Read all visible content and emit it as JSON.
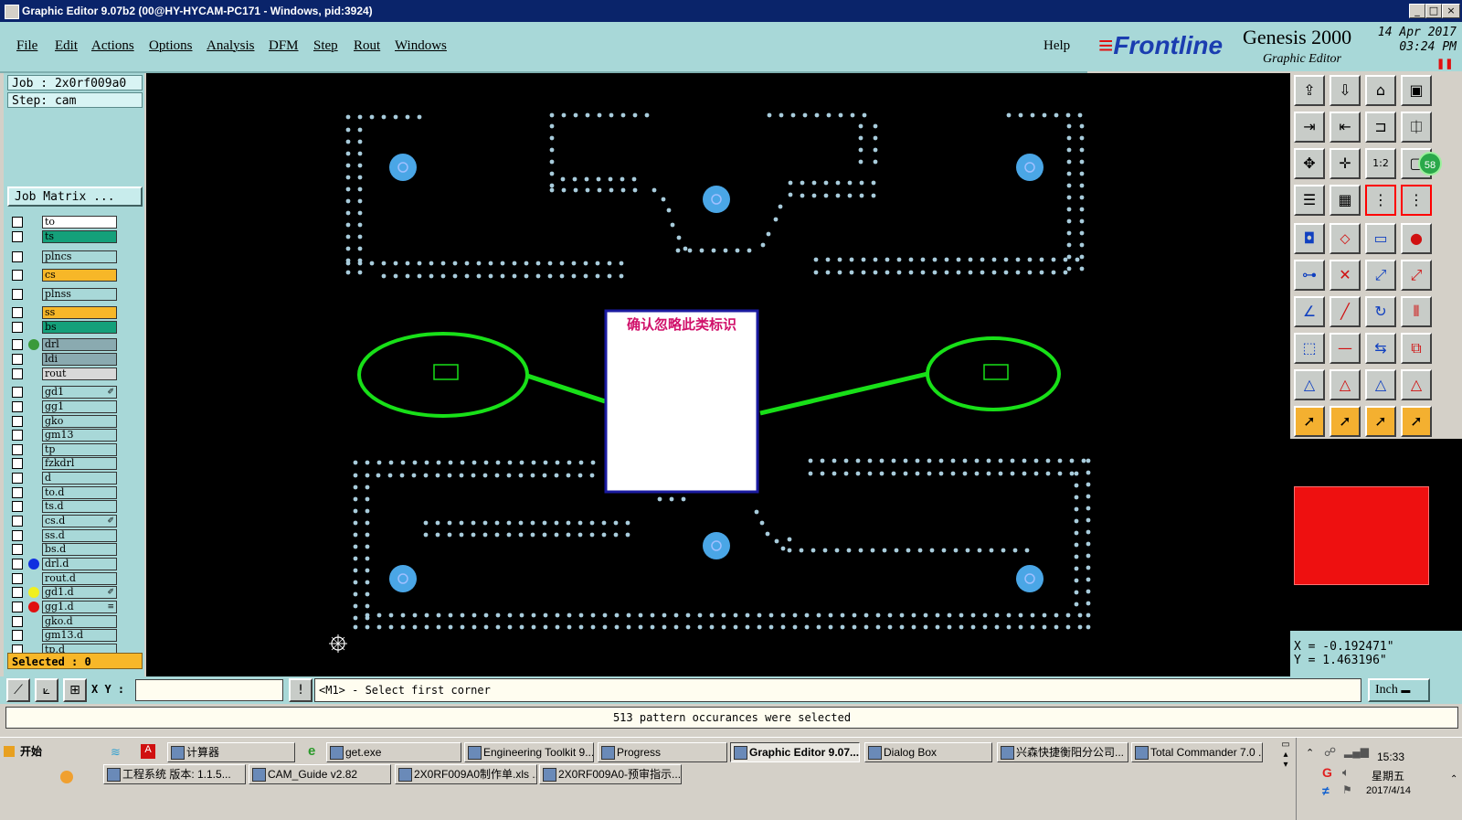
{
  "window": {
    "title": "Graphic Editor 9.07b2 (00@HY-HYCAM-PC171 - Windows, pid:3924)"
  },
  "menu": [
    "File",
    "Edit",
    "Actions",
    "Options",
    "Analysis",
    "DFM",
    "Step",
    "Rout",
    "Windows"
  ],
  "help": "Help",
  "brand": {
    "logo": "Frontline",
    "product": "Genesis 2000",
    "subtitle": "Graphic Editor",
    "date": "14 Apr 2017",
    "time": "03:24 PM"
  },
  "job": {
    "job_line": "Job : 2x0rf009a0",
    "step_line": "Step: cam",
    "matrix_button": "Job Matrix ..."
  },
  "layers": [
    {
      "name": "to",
      "color": "#ffffff"
    },
    {
      "name": "ts",
      "color": "#14a07a"
    },
    {
      "name": "plncs",
      "color": "#a8d8d8"
    },
    {
      "name": "cs",
      "color": "#f7b728"
    },
    {
      "name": "plnss",
      "color": "#a8d8d8"
    },
    {
      "name": "ss",
      "color": "#f7b728"
    },
    {
      "name": "bs",
      "color": "#14a07a"
    },
    {
      "name": "drl",
      "color": "#8aaab0",
      "dot": "#3a9a3a"
    },
    {
      "name": "ldi",
      "color": "#8aaab0"
    },
    {
      "name": "rout",
      "color": "#d8d8d8"
    },
    {
      "name": "gd1",
      "color": "#a8d8d8",
      "mark": "✐"
    },
    {
      "name": "gg1",
      "color": "#a8d8d8"
    },
    {
      "name": "gko",
      "color": "#a8d8d8"
    },
    {
      "name": "gm13",
      "color": "#a8d8d8"
    },
    {
      "name": "tp",
      "color": "#a8d8d8"
    },
    {
      "name": "fzkdrl",
      "color": "#a8d8d8"
    },
    {
      "name": "d",
      "color": "#a8d8d8"
    },
    {
      "name": "to.d",
      "color": "#a8d8d8"
    },
    {
      "name": "ts.d",
      "color": "#a8d8d8"
    },
    {
      "name": "cs.d",
      "color": "#a8d8d8",
      "mark": "✐"
    },
    {
      "name": "ss.d",
      "color": "#a8d8d8"
    },
    {
      "name": "bs.d",
      "color": "#a8d8d8"
    },
    {
      "name": "drl.d",
      "color": "#a8d8d8",
      "dot": "#1030e0"
    },
    {
      "name": "rout.d",
      "color": "#a8d8d8"
    },
    {
      "name": "gd1.d",
      "color": "#a8d8d8",
      "dot": "#f0f020",
      "mark": "✐"
    },
    {
      "name": "gg1.d",
      "color": "#a8d8d8",
      "dot": "#e01010",
      "mark": "≡"
    },
    {
      "name": "gko.d",
      "color": "#a8d8d8"
    },
    {
      "name": "gm13.d",
      "color": "#a8d8d8"
    },
    {
      "name": "tp.d",
      "color": "#a8d8d8"
    }
  ],
  "selected_label": "Selected : 0",
  "annotation": "确认忽略此类标识",
  "coords": {
    "x": "X = -0.192471\"",
    "y": "Y = 1.463196\""
  },
  "cmd": {
    "xy_label": "X Y :",
    "message": "<M1> - Select first corner",
    "units": "Inch"
  },
  "status": "513 pattern occurances were selected",
  "badge": "58",
  "taskbar": {
    "start": "开始",
    "row1": [
      "计算器",
      "get.exe",
      "Engineering Toolkit 9....",
      "Progress",
      "Graphic Editor 9.07...",
      "Dialog Box",
      "兴森快捷衡阳分公司...",
      "Total Commander 7.0 ..."
    ],
    "row2": [
      "工程系统  版本: 1.1.5...",
      "CAM_Guide v2.82",
      "2X0RF009A0制作单.xls ...",
      "2X0RF009A0-预审指示...."
    ],
    "clock": "15:33",
    "weekday": "星期五",
    "date": "2017/4/14"
  }
}
